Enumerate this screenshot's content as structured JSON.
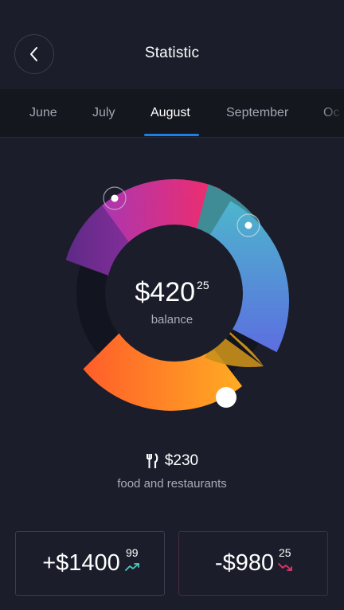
{
  "header": {
    "title": "Statistic",
    "back_icon": "chevron-left-icon"
  },
  "months": [
    "June",
    "July",
    "August",
    "September",
    "Oc"
  ],
  "active_month": "August",
  "balance": {
    "amount": "$420",
    "cents": "25",
    "label": "balance"
  },
  "category": {
    "icon": "fork-knife-icon",
    "amount": "$230",
    "label": "food and restaurants"
  },
  "income": {
    "amount": "+$1400",
    "cents": "99",
    "icon": "trend-up-icon",
    "color": "#4ec9c0"
  },
  "expense": {
    "amount": "-$980",
    "cents": "25",
    "icon": "trend-down-icon",
    "color": "#e8326e"
  },
  "colors": {
    "background": "#1b1d2a",
    "tab_accent": "#1d7ee3"
  }
}
